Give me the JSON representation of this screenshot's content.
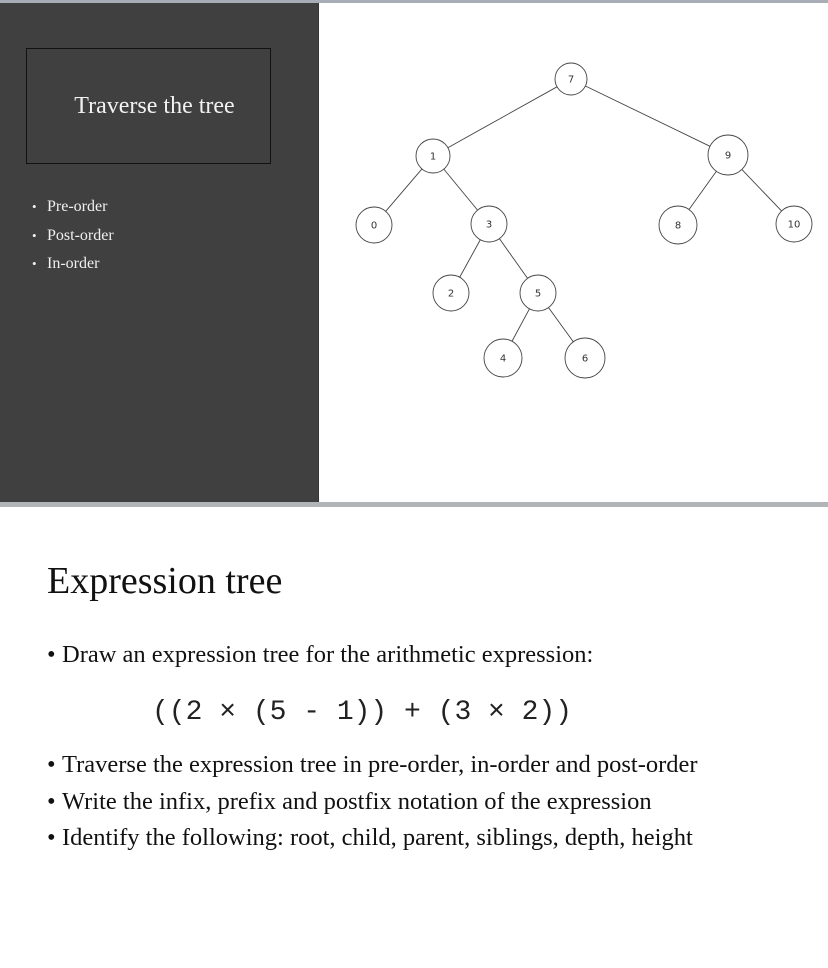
{
  "slide1": {
    "title": "Traverse the tree",
    "bullets": [
      "Pre-order",
      "Post-order",
      "In-order"
    ],
    "tree": {
      "nodes": [
        {
          "id": "7",
          "label": "7"
        },
        {
          "id": "1",
          "label": "1"
        },
        {
          "id": "9",
          "label": "9"
        },
        {
          "id": "0",
          "label": "0"
        },
        {
          "id": "3",
          "label": "3"
        },
        {
          "id": "8",
          "label": "8"
        },
        {
          "id": "10",
          "label": "10"
        },
        {
          "id": "2",
          "label": "2"
        },
        {
          "id": "5",
          "label": "5"
        },
        {
          "id": "4",
          "label": "4"
        },
        {
          "id": "6",
          "label": "6"
        }
      ],
      "edges": [
        [
          "7",
          "1"
        ],
        [
          "7",
          "9"
        ],
        [
          "1",
          "0"
        ],
        [
          "1",
          "3"
        ],
        [
          "9",
          "8"
        ],
        [
          "9",
          "10"
        ],
        [
          "3",
          "2"
        ],
        [
          "3",
          "5"
        ],
        [
          "5",
          "4"
        ],
        [
          "5",
          "6"
        ]
      ]
    }
  },
  "slide2": {
    "title": "Expression tree",
    "bullet_marker": "•",
    "intro_bullet": "Draw an expression tree for the arithmetic expression:",
    "expression": "((2 × (5 - 1)) + (3 × 2))",
    "bullets": [
      "Traverse the expression tree in pre-order, in-order and post-order",
      "Write the infix, prefix and postfix notation of the expression",
      "Identify the following: root, child, parent, siblings, depth, height"
    ]
  }
}
